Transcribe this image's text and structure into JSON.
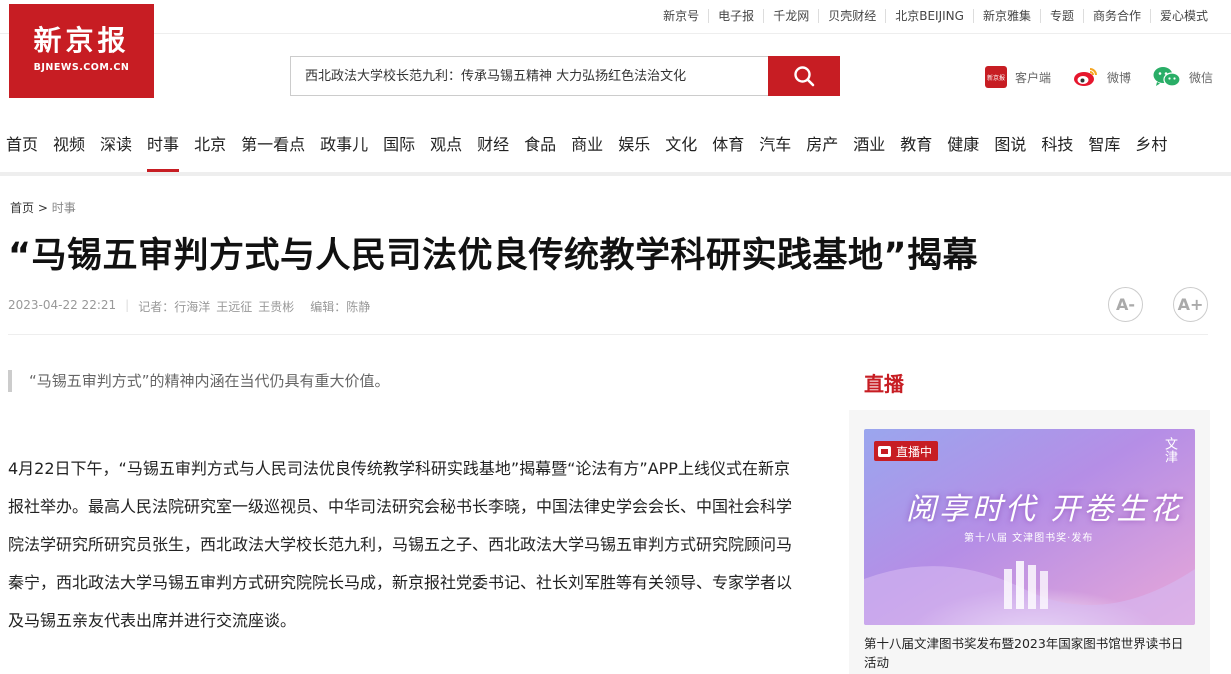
{
  "topbar": {
    "links": [
      "新京号",
      "电子报",
      "千龙网",
      "贝壳财经",
      "北京BEIJING",
      "新京雅集",
      "专题",
      "商务合作",
      "爱心模式"
    ]
  },
  "logo": {
    "cn": "新京报",
    "en": "BJNEWS.COM.CN"
  },
  "search": {
    "placeholder": "西北政法大学校长范九利：传承马锡五精神 大力弘扬红色法治文化"
  },
  "apps": {
    "client": "客户端",
    "client_icon_text": "新京报",
    "weibo": "微博",
    "wechat": "微信"
  },
  "nav": {
    "items": [
      "首页",
      "视频",
      "深读",
      "时事",
      "北京",
      "第一看点",
      "政事儿",
      "国际",
      "观点",
      "财经",
      "食品",
      "商业",
      "娱乐",
      "文化",
      "体育",
      "汽车",
      "房产",
      "酒业",
      "教育",
      "健康",
      "图说",
      "科技",
      "智库",
      "乡村"
    ],
    "active_index": 3
  },
  "breadcrumb": {
    "home": "首页",
    "separator": ">",
    "current": "时事"
  },
  "article": {
    "title": "“马锡五审判方式与人民司法优良传统教学科研实践基地”揭幕",
    "datetime": "2023-04-22 22:21",
    "reporter_label": "记者：",
    "reporters": [
      "行海洋",
      "王远征",
      "王贵彬"
    ],
    "editor_label": "编辑：",
    "editor": "陈静",
    "font_buttons": [
      "A-",
      "A+"
    ],
    "lead": "“马锡五审判方式”的精神内涵在当代仍具有重大价值。",
    "body": "4月22日下午，“马锡五审判方式与人民司法优良传统教学科研实践基地”揭幕暨“论法有方”APP上线仪式在新京报社举办。最高人民法院研究室一级巡视员、中华司法研究会秘书长李晓，中国法律史学会会长、中国社会科学院法学研究所研究员张生，西北政法大学校长范九利，马锡五之子、西北政法大学马锡五审判方式研究院顾问马秦宁，西北政法大学马锡五审判方式研究院院长马成，新京报社党委书记、社长刘军胜等有关领导、专家学者以及马锡五亲友代表出席并进行交流座谈。"
  },
  "live": {
    "heading": "直播",
    "badge": "直播中",
    "poster_title": "阅享时代 开卷生花",
    "poster_sub": "第十八届 文津图书奖·发布",
    "poster_corner": "文津",
    "caption": "第十八届文津图书奖发布暨2023年国家图书馆世界读书日活动"
  },
  "colors": {
    "brand_red": "#c71d23"
  }
}
